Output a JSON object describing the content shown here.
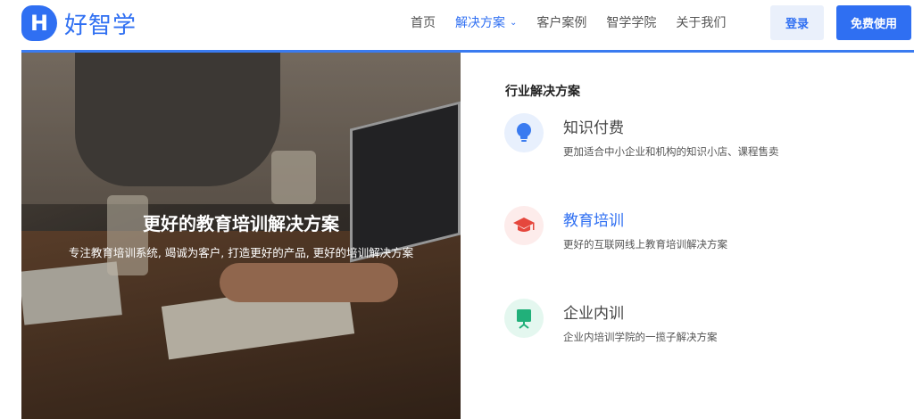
{
  "brand": {
    "badge": "H",
    "name": "好智学",
    "color": "#2f6ff2"
  },
  "nav": {
    "items": [
      {
        "label": "首页",
        "active": false
      },
      {
        "label": "解决方案",
        "active": true,
        "has_dropdown": true
      },
      {
        "label": "客户案例",
        "active": false
      },
      {
        "label": "智学学院",
        "active": false
      },
      {
        "label": "关于我们",
        "active": false
      }
    ],
    "login_label": "登录",
    "free_label": "免费使用"
  },
  "banner": {
    "title": "更好的教育培训解决方案",
    "subtitle": "专注教育培训系统, 竭诚为客户, 打造更好的产品, 更好的培训解决方案"
  },
  "panel": {
    "heading": "行业解决方案",
    "solutions": [
      {
        "title": "知识付费",
        "desc": "更加适合中小企业和机构的知识小店、课程售卖",
        "icon": "lightbulb-icon",
        "icon_color": "#3a7bf0",
        "icon_bg": "#e8f0fd",
        "active": false
      },
      {
        "title": "教育培训",
        "desc": "更好的互联网线上教育培训解决方案",
        "icon": "graduation-cap-icon",
        "icon_color": "#e5473d",
        "icon_bg": "#fdeceb",
        "active": true
      },
      {
        "title": "企业内训",
        "desc": "企业内培训学院的一揽子解决方案",
        "icon": "presentation-board-icon",
        "icon_color": "#21b07a",
        "icon_bg": "#e4f7ef",
        "active": false
      }
    ]
  }
}
